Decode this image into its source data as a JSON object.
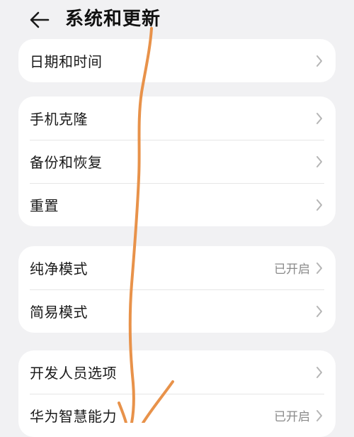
{
  "header": {
    "back_icon": "back-arrow-icon",
    "title": "系统和更新"
  },
  "groups": [
    {
      "items": [
        {
          "label": "日期和时间",
          "value": ""
        }
      ]
    },
    {
      "items": [
        {
          "label": "手机克隆",
          "value": ""
        },
        {
          "label": "备份和恢复",
          "value": ""
        },
        {
          "label": "重置",
          "value": ""
        }
      ]
    },
    {
      "items": [
        {
          "label": "纯净模式",
          "value": "已开启"
        },
        {
          "label": "简易模式",
          "value": ""
        }
      ]
    },
    {
      "items": [
        {
          "label": "开发人员选项",
          "value": ""
        },
        {
          "label": "华为智慧能力",
          "value": "已开启"
        }
      ]
    }
  ],
  "colors": {
    "background": "#f1f1f3",
    "card": "#ffffff",
    "annotation": "#e8924a"
  }
}
